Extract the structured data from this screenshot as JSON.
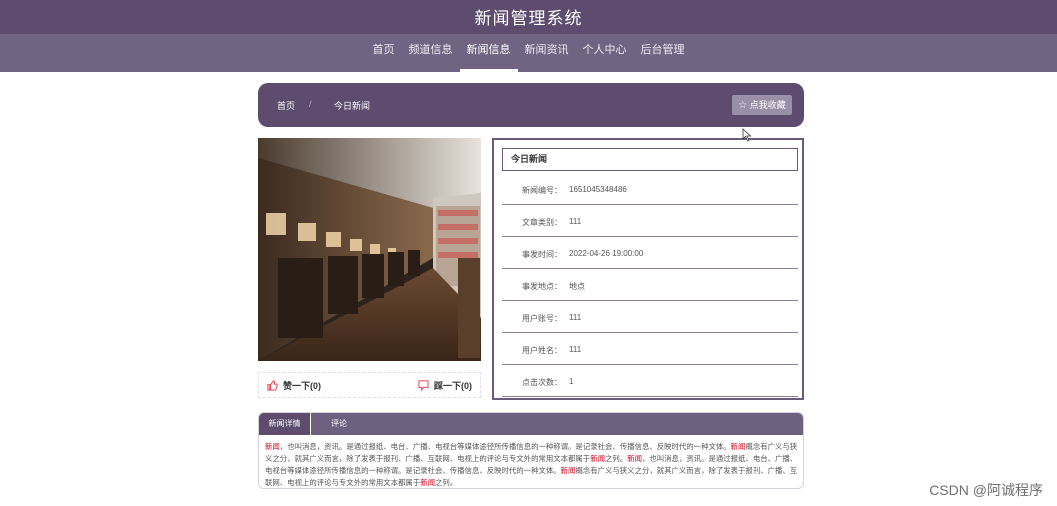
{
  "site": {
    "title": "新闻管理系统"
  },
  "nav": [
    {
      "label": "首页"
    },
    {
      "label": "频道信息"
    },
    {
      "label": "新闻信息",
      "active": true
    },
    {
      "label": "新闻资讯"
    },
    {
      "label": "个人中心"
    },
    {
      "label": "后台管理"
    }
  ],
  "breadcrumb": {
    "home": "首页",
    "separator": "/",
    "current": "今日新闻"
  },
  "favorite": {
    "label": "点我收藏",
    "icon": "star-icon"
  },
  "votes": {
    "like": "赞一下(0)",
    "dislike": "踩一下(0)"
  },
  "info": {
    "title": "今日新闻",
    "rows": [
      {
        "label": "新闻编号：",
        "value": "1651045348486"
      },
      {
        "label": "文章类别：",
        "value": "111"
      },
      {
        "label": "事发时间：",
        "value": "2022-04-26 19:00:00"
      },
      {
        "label": "事发地点：",
        "value": "地点"
      },
      {
        "label": "用户账号：",
        "value": "111"
      },
      {
        "label": "用户姓名：",
        "value": "111"
      },
      {
        "label": "点击次数：",
        "value": "1"
      }
    ]
  },
  "tabs": {
    "detail": "新闻详情",
    "comment": "评论"
  },
  "content": {
    "s1": "新闻",
    "s2": "，也叫消息，资讯。是通过报纸、电台、广播、电视台等媒体途径所传播信息的一种称谓。是记录社会、传播信息、反映时代的一种文体。",
    "s3": "新闻",
    "s4": "概念有广义与狭义之分，就其广义而言，除了发表于报刊、广播、互联网、电视上的评论与专文外的常用文本都属于",
    "s5": "新闻",
    "s6": "之列。",
    "s7": "新闻",
    "s8": "，也叫消息，资讯。是通过报纸、电台、广播、电视台等媒体途径所传播信息的一种称谓。是记录社会、传播信息、反映时代的一种文体。",
    "s9": "新闻",
    "s10": "概念有广义与狭义之分，就其广义而言，除了发表于报刊、广播、互联网、电视上的评论与专文外的常用文本都属于",
    "s11": "新闻",
    "s12": "之列。"
  },
  "watermark": "CSDN @阿诚程序",
  "colors": {
    "primary": "#5d4c6e",
    "nav": "#716482",
    "keyword": "#d0021b",
    "like": "#e34a5b"
  }
}
